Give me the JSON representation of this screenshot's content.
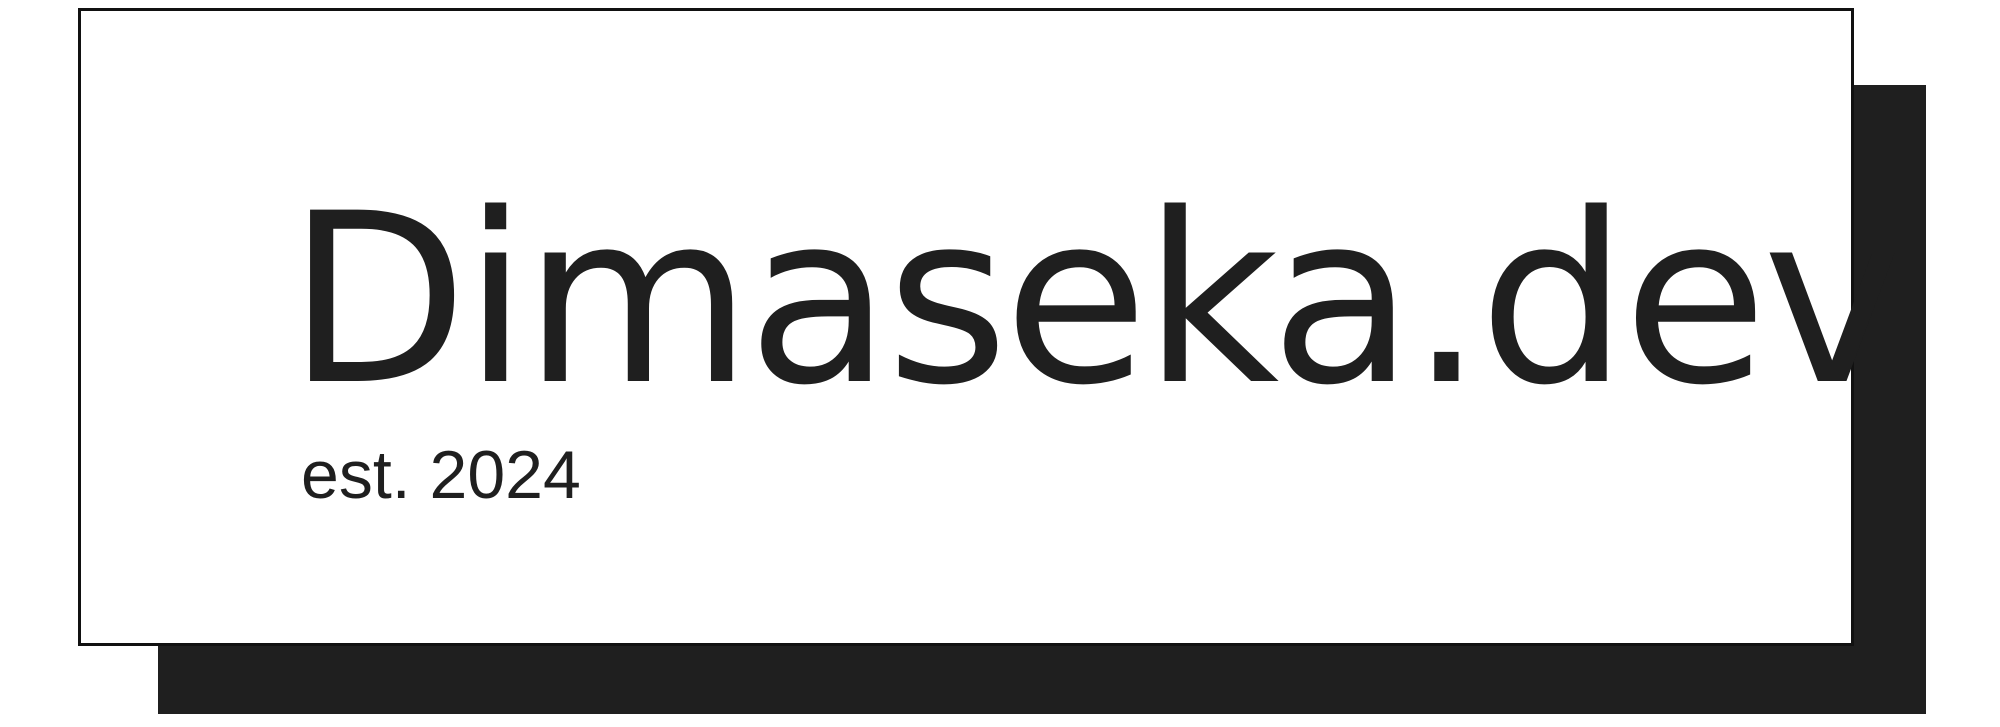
{
  "logo": {
    "name": "Dimaseka.dev",
    "tagline": "est. 2024"
  },
  "colors": {
    "background": "#ffffff",
    "ink": "#1f1f1f",
    "border": "#111111"
  }
}
